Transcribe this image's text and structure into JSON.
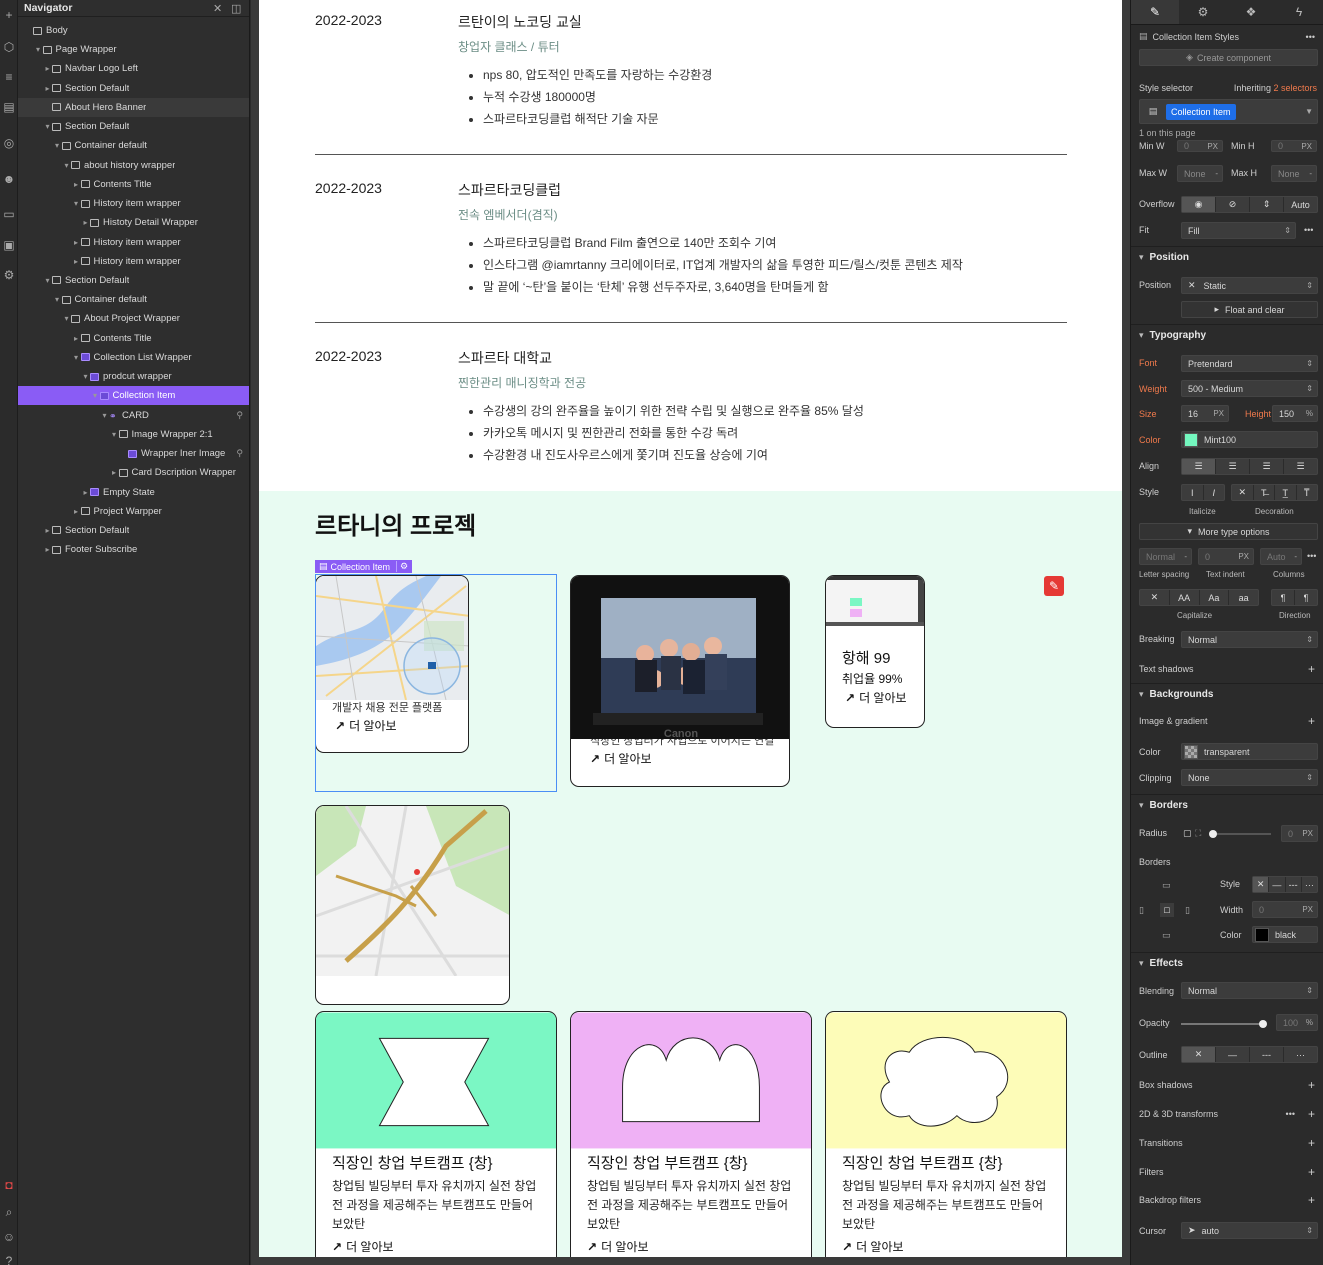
{
  "navigator": {
    "title": "Navigator",
    "tree": [
      {
        "label": "Body",
        "depth": 0,
        "caret": "",
        "icon": "body-icon"
      },
      {
        "label": "Page Wrapper",
        "depth": 1,
        "caret": "▾",
        "icon": "box-icon"
      },
      {
        "label": "Navbar Logo Left",
        "depth": 2,
        "caret": "▸",
        "icon": "section-icon"
      },
      {
        "label": "Section Default",
        "depth": 2,
        "caret": "▸",
        "icon": "section-icon"
      },
      {
        "label": "About Hero Banner",
        "depth": 2,
        "caret": "",
        "icon": "box-icon",
        "hover": true
      },
      {
        "label": "Section Default",
        "depth": 2,
        "caret": "▾",
        "icon": "section-icon"
      },
      {
        "label": "Container default",
        "depth": 3,
        "caret": "▾",
        "icon": "container-icon"
      },
      {
        "label": "about history wrapper",
        "depth": 4,
        "caret": "▾",
        "icon": "box-icon"
      },
      {
        "label": "Contents Title",
        "depth": 5,
        "caret": "▸",
        "icon": "box-icon"
      },
      {
        "label": "History item wrapper",
        "depth": 5,
        "caret": "▾",
        "icon": "box-icon"
      },
      {
        "label": "Histoty Detail Wrapper",
        "depth": 6,
        "caret": "▸",
        "icon": "box-icon"
      },
      {
        "label": "History item wrapper",
        "depth": 5,
        "caret": "▸",
        "icon": "box-icon"
      },
      {
        "label": "History item wrapper",
        "depth": 5,
        "caret": "▸",
        "icon": "box-icon"
      },
      {
        "label": "Section Default",
        "depth": 2,
        "caret": "▾",
        "icon": "section-icon"
      },
      {
        "label": "Container default",
        "depth": 3,
        "caret": "▾",
        "icon": "container-icon"
      },
      {
        "label": "About Project Wrapper",
        "depth": 4,
        "caret": "▾",
        "icon": "box-icon"
      },
      {
        "label": "Contents Title",
        "depth": 5,
        "caret": "▸",
        "icon": "box-icon"
      },
      {
        "label": "Collection List Wrapper",
        "depth": 5,
        "caret": "▾",
        "icon": "collection-icon"
      },
      {
        "label": "prodcut wrapper",
        "depth": 6,
        "caret": "▾",
        "icon": "collection-icon"
      },
      {
        "label": "Collection Item",
        "depth": 7,
        "caret": "▾",
        "icon": "collection-icon",
        "selected": true
      },
      {
        "label": "CARD",
        "depth": 8,
        "caret": "▾",
        "icon": "link-icon",
        "pin": true
      },
      {
        "label": "Image Wrapper 2:1",
        "depth": 9,
        "caret": "▾",
        "icon": "box-icon"
      },
      {
        "label": "Wrapper Iner Image",
        "depth": 10,
        "caret": "",
        "icon": "image-icon",
        "pin": true
      },
      {
        "label": "Card Dscription Wrapper",
        "depth": 9,
        "caret": "▸",
        "icon": "box-icon"
      },
      {
        "label": "Empty State",
        "depth": 6,
        "caret": "▸",
        "icon": "collection-icon"
      },
      {
        "label": "Project Warpper",
        "depth": 5,
        "caret": "▸",
        "icon": "box-icon"
      },
      {
        "label": "Section Default",
        "depth": 2,
        "caret": "▸",
        "icon": "section-icon"
      },
      {
        "label": "Footer Subscribe",
        "depth": 2,
        "caret": "▸",
        "icon": "section-icon"
      }
    ]
  },
  "history": [
    {
      "year": "2022-2023",
      "title": "르탄이의 노코딩 교실",
      "role": "창업자 클래스 / 튜터",
      "bullets": [
        "nps 80, 압도적인 만족도를 자랑하는 수강환경",
        "누적 수강생 180000명",
        "스파르타코딩클럽 해적단 기술 자문"
      ]
    },
    {
      "year": "2022-2023",
      "title": "스파르타코딩클럽",
      "role": "전속 엠베서더(겸직)",
      "bullets": [
        "스파르타코딩클럽 Brand Film 출연으로 140만 조회수 기여",
        "인스타그램 @iamrtanny 크리에이터로, IT업계 개발자의 삶을 투영한 피드/릴스/컷툰 콘텐츠 제작",
        "말 끝에 ‘~탄’을 붙이는 ‘탄체’ 유행 선두주자로, 3,640명을 탄며들게 함"
      ]
    },
    {
      "year": "2022-2023",
      "title": "스파르타 대학교",
      "role": "찐한관리 매니징학과 전공",
      "bullets": [
        "수강생의 강의 완주율을 높이기 위한 전략 수립 및 실행으로 완주율 85% 달성",
        "카카오톡 메시지 및 찐한관리 전화를 통한 수강 독려",
        "수강환경 내 진도사우르스에게 쫓기며 진도율 상승에 기여"
      ]
    }
  ],
  "projects": {
    "heading": "르타니의 프로젝",
    "selection_tag": "Collection Item",
    "card1": {
      "caption": "개발자 채용 전문 플랫폼",
      "more": "더 알아보"
    },
    "card2": {
      "caption": "직장인 창업러가 사업으로 이어지는 연결",
      "more": "더 알아보",
      "brand": "Canon"
    },
    "card3": {
      "title": "항해 99",
      "sub": "취업율 99%",
      "more": "더 알아보"
    },
    "card4": {
      "more": ""
    },
    "bootcamps": [
      {
        "title": "직장인 창업 부트캠프 {창}",
        "desc": "창업팀 빌딩부터 투자 유치까지 실전 창업 전 과정을 제공해주는 부트캠프도 만들어 보았탄",
        "more": "더 알아보",
        "color": "#7bf7c4",
        "shape": "bowtie"
      },
      {
        "title": "직장인 창업 부트캠프 {창}",
        "desc": "창업팀 빌딩부터 투자 유치까지 실전 창업 전 과정을 제공해주는 부트캠프도 만들어 보았탄",
        "more": "더 알아보",
        "color": "#efb1f5",
        "shape": "crown"
      },
      {
        "title": "직장인 창업 부트캠프 {창}",
        "desc": "창업팀 빌딩부터 투자 유치까지 실전 창업 전 과정을 제공해주는 부트캠프도 만들어 보았탄",
        "more": "더 알아보",
        "color": "#fdfcb8",
        "shape": "cloud"
      }
    ]
  },
  "style_panel": {
    "header": "Collection Item Styles",
    "create_component": "Create component",
    "style_selector_label": "Style selector",
    "inheriting": "Inheriting",
    "inheriting_count": "2 selectors",
    "selector_value": "Collection Item",
    "on_page": "1 on this page",
    "size": {
      "min_w": "Min W",
      "min_h": "Min H",
      "max_w": "Max W",
      "max_h": "Max H",
      "zero": "0",
      "px": "PX",
      "none": "None"
    },
    "overflow_label": "Overflow",
    "overflow_auto": "Auto",
    "fit_label": "Fit",
    "fit_value": "Fill",
    "position_title": "Position",
    "position_label": "Position",
    "position_value": "Static",
    "float_clear": "Float and clear",
    "typography_title": "Typography",
    "font_label": "Font",
    "font_value": "Pretendard",
    "weight_label": "Weight",
    "weight_value": "500 - Medium",
    "size_label": "Size",
    "size_value": "16",
    "size_unit": "PX",
    "height_label": "Height",
    "height_value": "150",
    "height_unit": "%",
    "color_label": "Color",
    "color_value": "Mint100",
    "color_hex": "#74f7bf",
    "align_label": "Align",
    "style_label": "Style",
    "italicize": "Italicize",
    "decoration": "Decoration",
    "more_type": "More type options",
    "ls_normal": "Normal",
    "ti_zero": "0",
    "col_auto": "Auto",
    "letter_spacing": "Letter spacing",
    "text_indent": "Text indent",
    "columns": "Columns",
    "cap_aa1": "AA",
    "cap_aa2": "Aa",
    "cap_aa3": "aa",
    "capitalize": "Capitalize",
    "direction": "Direction",
    "breaking_label": "Breaking",
    "breaking_value": "Normal",
    "text_shadows": "Text shadows",
    "backgrounds_title": "Backgrounds",
    "image_gradient": "Image & gradient",
    "bg_color_label": "Color",
    "bg_color_value": "transparent",
    "clipping_label": "Clipping",
    "clipping_value": "None",
    "borders_title": "Borders",
    "radius_label": "Radius",
    "radius_value": "0",
    "radius_unit": "PX",
    "borders_label": "Borders",
    "b_style": "Style",
    "b_width": "Width",
    "b_width_value": "0",
    "b_width_unit": "PX",
    "b_color": "Color",
    "b_color_value": "black",
    "effects_title": "Effects",
    "blending_label": "Blending",
    "blending_value": "Normal",
    "opacity_label": "Opacity",
    "opacity_value": "100",
    "opacity_unit": "%",
    "outline_label": "Outline",
    "box_shadows": "Box shadows",
    "transforms": "2D & 3D transforms",
    "transitions": "Transitions",
    "filters": "Filters",
    "backdrop": "Backdrop filters",
    "cursor_label": "Cursor",
    "cursor_value": "auto"
  }
}
